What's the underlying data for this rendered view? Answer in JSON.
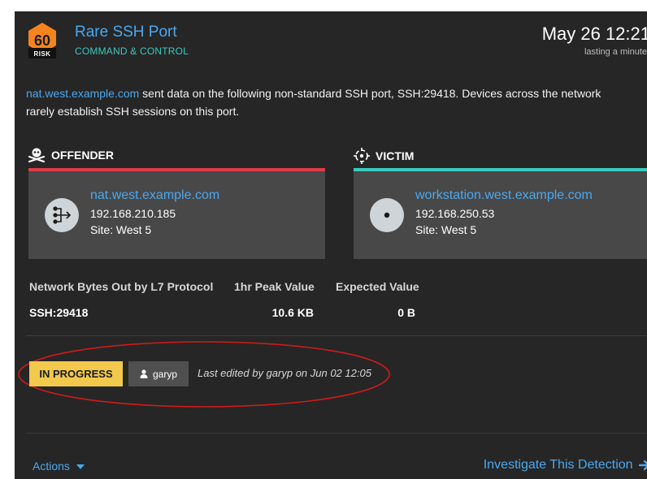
{
  "detection": {
    "risk_score": "60",
    "risk_label": "RISK",
    "title": "Rare SSH Port",
    "category": "COMMAND & CONTROL",
    "timestamp": "May 26 12:21",
    "duration": "lasting a minute",
    "description": {
      "link": "nat.west.example.com",
      "text": " sent data on the following non-standard SSH port, SSH:29418. Devices across the network rarely establish SSH sessions on this port."
    }
  },
  "offender": {
    "heading": "OFFENDER",
    "name": "nat.west.example.com",
    "ip": "192.168.210.185",
    "site": "Site: West 5",
    "icon": "nat-router-icon"
  },
  "victim": {
    "heading": "VICTIM",
    "name": "workstation.west.example.com",
    "ip": "192.168.250.53",
    "site": "Site: West 5",
    "icon": "workstation-icon"
  },
  "metrics": {
    "headers": [
      "Network Bytes Out by L7 Protocol",
      "1hr Peak Value",
      "Expected Value"
    ],
    "rows": [
      {
        "protocol": "SSH:29418",
        "peak": "10.6 KB",
        "expected": "0 B"
      }
    ]
  },
  "status": {
    "label": "IN PROGRESS",
    "assignee": "garyp",
    "edited": "Last edited by garyp on Jun 02 12:05"
  },
  "footer": {
    "actions": "Actions",
    "investigate": "Investigate This Detection"
  },
  "colors": {
    "link": "#4aa8ef",
    "category": "#3cc9c0",
    "offender_bar": "#e03a4a",
    "victim_bar": "#3cc9c0",
    "risk_badge": "#f5841f",
    "status": "#f2c94c",
    "annotation": "#d11a1a"
  }
}
